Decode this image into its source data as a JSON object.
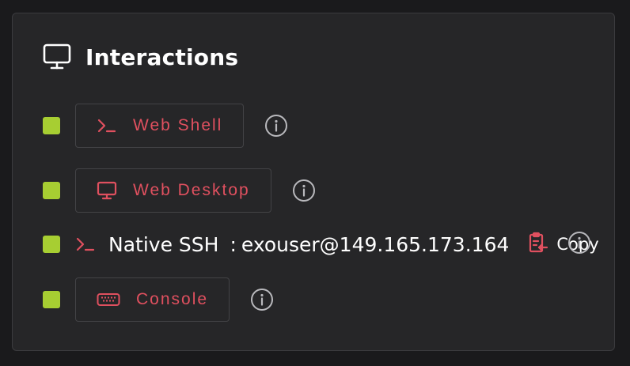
{
  "title": "Interactions",
  "accent_color": "#e0505f",
  "status_color": "#a7ce32",
  "items": [
    {
      "type": "button",
      "label": "Web Shell",
      "icon": "terminal-icon",
      "status": "ready"
    },
    {
      "type": "button",
      "label": "Web Desktop",
      "icon": "monitor-icon",
      "status": "ready"
    },
    {
      "type": "ssh",
      "label": "Native SSH",
      "separator": ":",
      "value": "exouser@149.165.173.164",
      "copy_label": "Copy",
      "icon": "terminal-icon",
      "status": "ready"
    },
    {
      "type": "button",
      "label": "Console",
      "icon": "keyboard-icon",
      "status": "ready"
    }
  ]
}
